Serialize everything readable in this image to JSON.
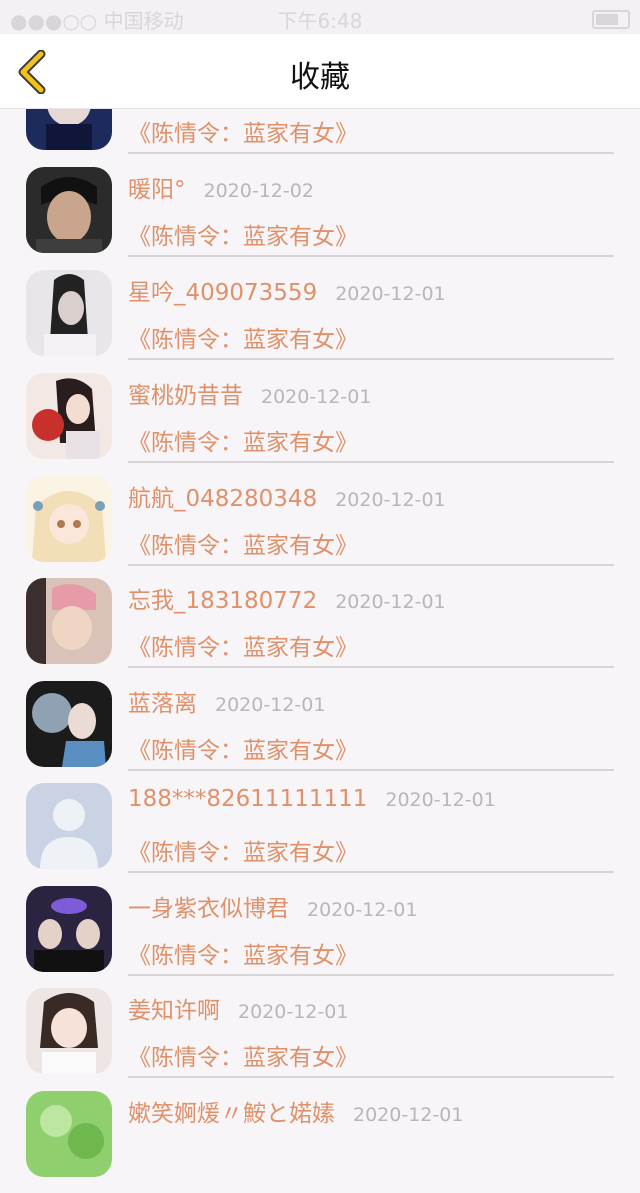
{
  "status_bar": {
    "carrier": "●●●○○ 中国移动",
    "time": "下午6:48"
  },
  "header": {
    "title": "收藏"
  },
  "items": [
    {
      "name": "",
      "date": "",
      "work": "《陈情令：蓝家有女》",
      "avatar": "partial"
    },
    {
      "name": "暖阳°",
      "date": "2020-12-02",
      "work": "《陈情令：蓝家有女》",
      "avatar": "photo-dark"
    },
    {
      "name": "星吟_409073559",
      "date": "2020-12-01",
      "work": "《陈情令：蓝家有女》",
      "avatar": "photo-grey"
    },
    {
      "name": "蜜桃奶昔昔",
      "date": "2020-12-01",
      "work": "《陈情令：蓝家有女》",
      "avatar": "anime-red"
    },
    {
      "name": "航航_048280348",
      "date": "2020-12-01",
      "work": "《陈情令：蓝家有女》",
      "avatar": "anime-cream"
    },
    {
      "name": "忘我_183180772",
      "date": "2020-12-01",
      "work": "《陈情令：蓝家有女》",
      "avatar": "photo-pink"
    },
    {
      "name": "蓝落离",
      "date": "2020-12-01",
      "work": "《陈情令：蓝家有女》",
      "avatar": "photo-blue"
    },
    {
      "name": "188***82611111111",
      "date": "2020-12-01",
      "work": "《陈情令：蓝家有女》",
      "avatar": "default"
    },
    {
      "name": "一身紫衣似博君",
      "date": "2020-12-01",
      "work": "《陈情令：蓝家有女》",
      "avatar": "photo-neon"
    },
    {
      "name": "姜知许啊",
      "date": "2020-12-01",
      "work": "《陈情令：蓝家有女》",
      "avatar": "photo-light"
    },
    {
      "name": "嫰笑婀煖〃鮟と婼嫊",
      "date": "2020-12-01",
      "work": "",
      "avatar": "green"
    }
  ],
  "colors": {
    "accent": "#e0916a",
    "date": "#b8b6b8",
    "back_icon": "#f2c21a"
  }
}
